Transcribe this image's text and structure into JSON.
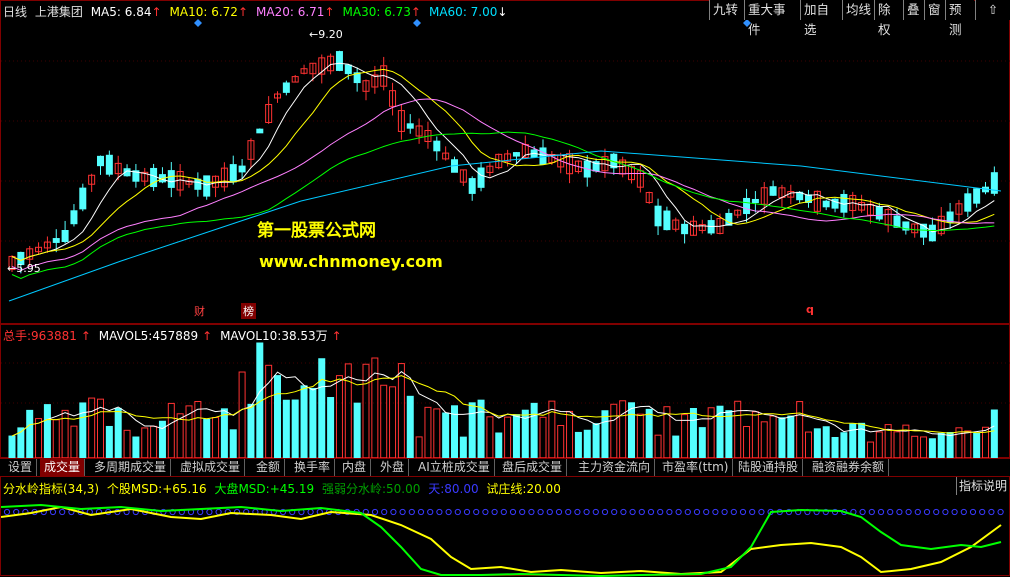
{
  "header": {
    "period": "日线",
    "stock_name": "上港集团",
    "ma": [
      {
        "label": "MA5:",
        "value": "6.84",
        "arrow": "up",
        "color": "#ffffff"
      },
      {
        "label": "MA10:",
        "value": "6.72",
        "arrow": "up",
        "color": "#ffff00"
      },
      {
        "label": "MA20:",
        "value": "6.71",
        "arrow": "up",
        "color": "#ff80ff"
      },
      {
        "label": "MA30:",
        "value": "6.73",
        "arrow": "up",
        "color": "#00ff00"
      },
      {
        "label": "MA60:",
        "value": "7.00",
        "arrow": "down",
        "color": "#00e0ff"
      }
    ]
  },
  "toolbar": {
    "items": [
      "九转",
      "重大事件",
      "加自选",
      "均线",
      "除权",
      "叠",
      "窗",
      "预测"
    ],
    "back_icon": "back-arrow-icon"
  },
  "price_labels": {
    "high": "9.20",
    "low": "5.95"
  },
  "watermark": {
    "line1": "第一股票公式网",
    "line2": "www.chnmoney.com"
  },
  "event_badges": {
    "cai": "财",
    "bang": "榜",
    "q": "q"
  },
  "volume_legend": {
    "total": {
      "label": "总手:",
      "value": "963881"
    },
    "mavol5": {
      "label": "MAVOL5:",
      "value": "457889"
    },
    "mavol10": {
      "label": "MAVOL10:",
      "value": "38.53万"
    }
  },
  "tabs": [
    "设置",
    "成交量",
    "多周期成交量",
    "虚拟成交量",
    "金额",
    "换手率",
    "内盘",
    "外盘",
    "AI立桩成交量",
    "盘后成交量",
    "主力资金流向",
    "市盈率(ttm)",
    "陆股通持股",
    "融资融券余额"
  ],
  "active_tab": "成交量",
  "indicator": {
    "name": "分水岭指标(34,3)",
    "msd_label": "个股MSD:",
    "msd_value": "+65.16",
    "big_label": "大盘MSD:",
    "big_value": "+45.19",
    "weak_label": "强弱分水岭:",
    "weak_value": "50.00",
    "sky_label": "天:",
    "sky_value": "80.00",
    "test_label": "试庄线:",
    "test_value": "20.00",
    "help_button": "指标说明"
  },
  "colors": {
    "up": "#ff3232",
    "down": "#54ffff",
    "ma5": "#ffffff",
    "ma10": "#ffff00",
    "ma20": "#ff80ff",
    "ma30": "#00ff00",
    "ma60": "#00c8ff",
    "indicator_stock": "#ffff00",
    "indicator_market": "#00ff00"
  }
}
